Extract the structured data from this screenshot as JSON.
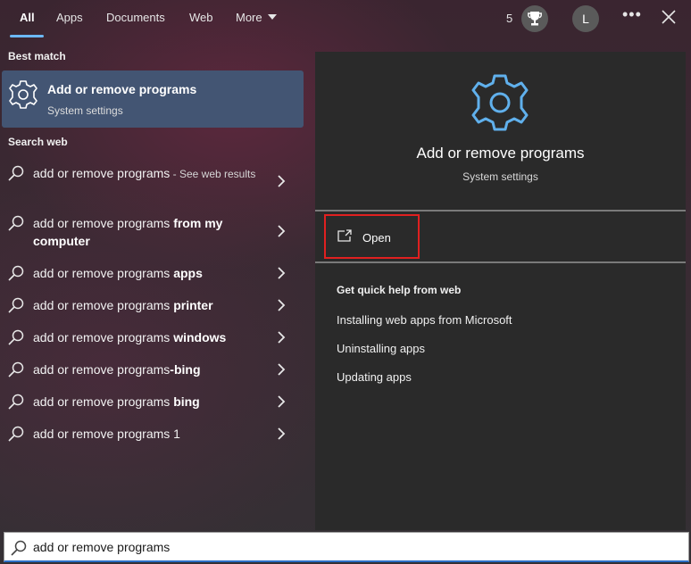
{
  "tabs": [
    {
      "label": "All",
      "active": true
    },
    {
      "label": "Apps"
    },
    {
      "label": "Documents"
    },
    {
      "label": "Web"
    },
    {
      "label": "More"
    }
  ],
  "header": {
    "rewards_count": "5",
    "avatar_initial": "L",
    "more_options_icon": "ellipsis-icon",
    "close_icon": "close-icon",
    "rewards_icon": "trophy-icon"
  },
  "best_match": {
    "section_label": "Best match",
    "title": "Add or remove programs",
    "subtitle": "System settings",
    "icon": "gear-icon"
  },
  "web_section_label": "Search web",
  "web_results": [
    {
      "query": "add or remove programs",
      "bold": "",
      "see": " - See web results"
    },
    {
      "query": "add or remove programs ",
      "bold": "from my computer",
      "see": ""
    },
    {
      "query": "add or remove programs ",
      "bold": "apps",
      "see": ""
    },
    {
      "query": "add or remove programs ",
      "bold": "printer",
      "see": ""
    },
    {
      "query": "add or remove programs ",
      "bold": "windows",
      "see": ""
    },
    {
      "query": "add or remove programs",
      "bold": "-bing",
      "see": ""
    },
    {
      "query": "add or remove programs ",
      "bold": "bing",
      "see": ""
    },
    {
      "query": "add or remove programs 1",
      "bold": "",
      "see": ""
    }
  ],
  "detail": {
    "title": "Add or remove programs",
    "subtitle": "System settings",
    "open_label": "Open",
    "help_title": "Get quick help from web",
    "help_links": [
      "Installing web apps from Microsoft",
      "Uninstalling apps",
      "Updating apps"
    ]
  },
  "search": {
    "value": "add or remove programs"
  },
  "colors": {
    "accent": "#6cb8f6",
    "selected_bg": "#435573",
    "highlight_box": "#e02020"
  }
}
